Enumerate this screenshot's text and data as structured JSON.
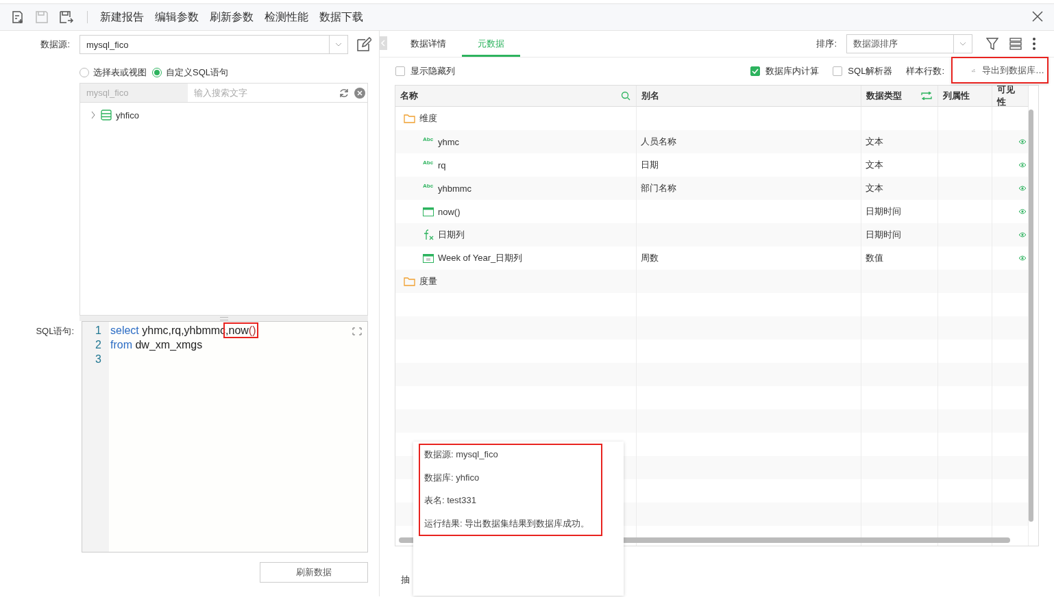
{
  "toolbar": {
    "icons": [
      {
        "kind": "new",
        "disabled": false
      },
      {
        "kind": "save",
        "disabled": true
      },
      {
        "kind": "save_as",
        "disabled": false
      }
    ],
    "menu": [
      "新建报告",
      "编辑参数",
      "刷新参数",
      "检测性能",
      "数据下载"
    ]
  },
  "left": {
    "datasource_label": "数据源:",
    "datasource": "mysql_fico",
    "modes": [
      {
        "label": "选择表或视图",
        "selected": false
      },
      {
        "label": "自定义SQL语句",
        "selected": true
      }
    ],
    "search": {
      "source": "mysql_fico",
      "placeholder": "输入搜索文字"
    },
    "tree": [
      {
        "label": "yhfico",
        "expanded": false
      }
    ],
    "sql_label": "SQL语句:",
    "sql_lines": [
      {
        "number": "1",
        "tokens": [
          {
            "text": "select",
            "kind": "keyword"
          },
          {
            "text": " yhmc,rq,yhbmmc",
            "kind": "plain"
          },
          {
            "kind": "highlight",
            "tokens": [
              {
                "text": ",now",
                "kind": "plain"
              },
              {
                "text": "()",
                "kind": "paren"
              }
            ]
          }
        ]
      },
      {
        "number": "2",
        "tokens": [
          {
            "text": "from",
            "kind": "keyword"
          },
          {
            "text": " dw_xm_xmgs",
            "kind": "plain"
          }
        ]
      },
      {
        "number": "3"
      }
    ],
    "refresh_button": "刷新数据"
  },
  "right": {
    "tabs": [
      {
        "label": "数据详情",
        "selected": false
      },
      {
        "label": "元数据",
        "selected": true
      }
    ],
    "sort_label": "排序:",
    "sort_value": "数据源排序",
    "options": [
      {
        "label": "显示隐藏列",
        "checked": false
      },
      {
        "label": "数据库内计算",
        "checked": true
      },
      {
        "label": "SQL解析器",
        "checked": false
      }
    ],
    "sample_label": "样本行数:",
    "columns": [
      "名称",
      "别名",
      "数据类型",
      "列属性",
      "可见性"
    ],
    "rows": [
      {
        "kind": "folder",
        "name": "维度"
      },
      {
        "kind": "text",
        "badge": "Abc",
        "name": "yhmc",
        "alias": "人员名称",
        "data_type": "文本",
        "visible": true
      },
      {
        "kind": "text",
        "badge": "Abc",
        "name": "rq",
        "alias": "日期",
        "data_type": "文本",
        "visible": true
      },
      {
        "kind": "text",
        "badge": "Abc",
        "name": "yhbmmc",
        "alias": "部门名称",
        "data_type": "文本",
        "visible": true
      },
      {
        "kind": "date",
        "name": "now()",
        "data_type": "日期时间",
        "visible": true
      },
      {
        "kind": "formula",
        "name": "日期列",
        "data_type": "日期时间",
        "visible": true
      },
      {
        "kind": "week",
        "name": "Week of Year_日期列",
        "alias": "周数",
        "data_type": "数值",
        "visible": true
      },
      {
        "kind": "folder",
        "name": "度量"
      }
    ],
    "extract_label": "抽"
  },
  "menu_popup": {
    "items": [
      {
        "label": "导出到数据库…",
        "highlighted": true
      }
    ]
  },
  "result_popup": {
    "highlighted": true,
    "lines": [
      "数据源: mysql_fico",
      "数据库: yhfico",
      "表名: test331",
      "运行结果: 导出数据集结果到数据库成功。"
    ]
  }
}
